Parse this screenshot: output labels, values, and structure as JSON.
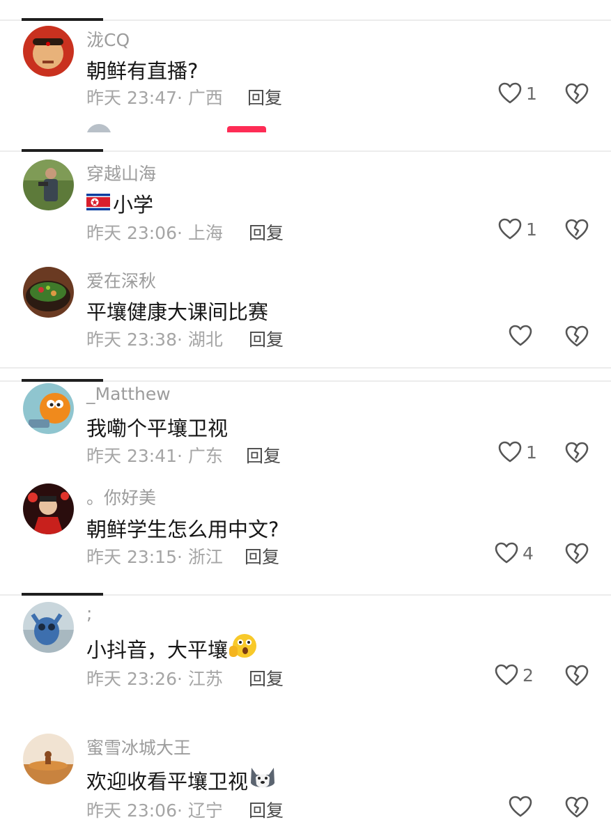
{
  "comments": [
    {
      "username": "泷CQ",
      "content": "朝鲜有直播?",
      "time": "昨天 23:47",
      "location": "广西",
      "reply": "回复",
      "likes": "1"
    },
    {
      "username": "穿越山海",
      "content": "小学",
      "time": "昨天 23:06",
      "location": "上海",
      "reply": "回复",
      "likes": "1",
      "flag": "north-korea-flag"
    },
    {
      "username": "爱在深秋",
      "content": "平壤健康大课间比赛",
      "time": "昨天 23:38",
      "location": "湖北",
      "reply": "回复",
      "likes": ""
    },
    {
      "username": "_Matthew",
      "content": "我嘞个平壤卫视",
      "time": "昨天 23:41",
      "location": "广东",
      "reply": "回复",
      "likes": "1"
    },
    {
      "username": "。你好美",
      "content": "朝鲜学生怎么用中文?",
      "time": "昨天 23:15",
      "location": "浙江",
      "reply": "回复",
      "likes": "4"
    },
    {
      "username": ";",
      "content": "小抖音，大平壤",
      "time": "昨天 23:26",
      "location": "江苏",
      "reply": "回复",
      "likes": "2",
      "emoji": "shocked-emoji"
    },
    {
      "username": "蜜雪冰城大王",
      "content": "欢迎收看平壤卫视",
      "time": "昨天 23:06",
      "location": "辽宁",
      "reply": "回复",
      "likes": "",
      "emoji": "husky-emoji"
    }
  ],
  "icons": {
    "like": "heart-outline-icon",
    "dislike": "broken-heart-icon"
  },
  "colors": {
    "text": "#161616",
    "muted": "#9c9c9c",
    "accent": "#fe2c55"
  }
}
